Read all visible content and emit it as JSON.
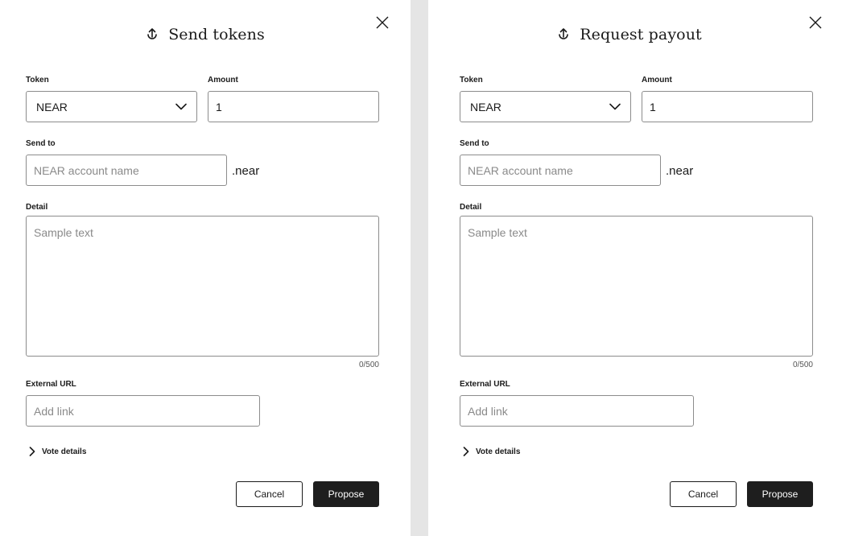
{
  "send_dialog": {
    "title": "Send tokens",
    "token_label": "Token",
    "token_value": "NEAR",
    "amount_label": "Amount",
    "amount_value": "1",
    "send_to_label": "Send to",
    "send_to_placeholder": "NEAR account name",
    "send_to_suffix": ".near",
    "detail_label": "Detail",
    "detail_placeholder": "Sample text",
    "detail_counter": "0/500",
    "external_url_label": "External URL",
    "external_url_placeholder": "Add link",
    "vote_details_label": "Vote details",
    "cancel_label": "Cancel",
    "propose_label": "Propose"
  },
  "payout_dialog": {
    "title": "Request payout",
    "token_label": "Token",
    "token_value": "NEAR",
    "amount_label": "Amount",
    "amount_value": "1",
    "send_to_label": "Send to",
    "send_to_placeholder": "NEAR account name",
    "send_to_suffix": ".near",
    "detail_label": "Detail",
    "detail_placeholder": "Sample text",
    "detail_counter": "0/500",
    "external_url_label": "External URL",
    "external_url_placeholder": "Add link",
    "vote_details_label": "Vote details",
    "cancel_label": "Cancel",
    "propose_label": "Propose"
  },
  "icons": {
    "title_icon": "upload-icon",
    "close_icon": "close-icon",
    "dropdown_icon": "chevron-down-icon",
    "disclosure_icon": "chevron-right-icon"
  },
  "colors": {
    "panel_background": "#ffffff",
    "gap_background": "#e5e5e5",
    "border": "#8c8c8c",
    "primary_button": "#1e1e1e"
  }
}
